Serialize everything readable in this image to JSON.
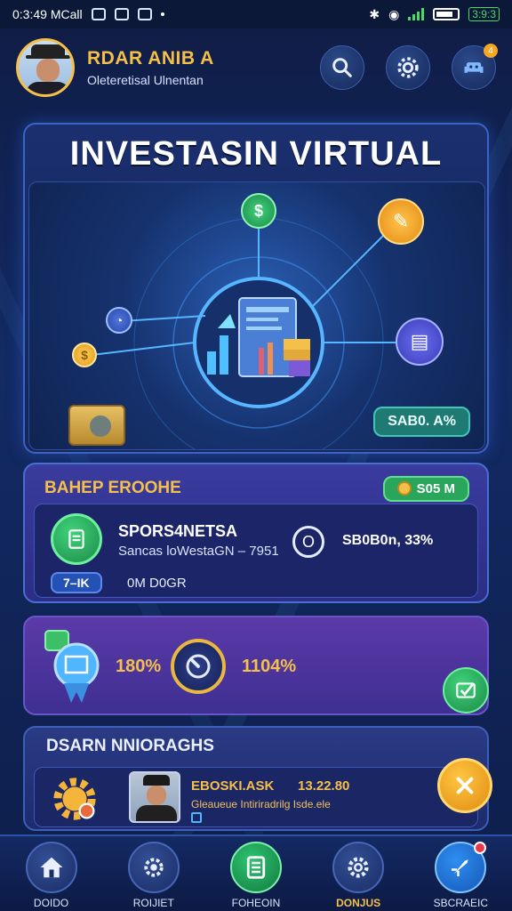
{
  "status_bar": {
    "time_carrier": "0:3:49 MCall",
    "battery_text": "3:9:3"
  },
  "header": {
    "user_name": "RDAR ANIB A",
    "user_subtitle": "Oleteretisal Ulnentan"
  },
  "hero": {
    "title": "INVESTASIN VIRTUAL",
    "badge": "SAB0. A%"
  },
  "balance_card": {
    "title": "BAHEP EROOHE",
    "pill": "S05 M",
    "fund_name": "SPORS4NETSA",
    "fund_desc": "Sancas loWestaGN – 7951",
    "ring_label": "O",
    "fund_value": "SB0B0n, 33%",
    "tag": "7–IK",
    "tag_text": "0M D0GR"
  },
  "stats_card": {
    "stat_one": "180%",
    "stat_two": "1104%"
  },
  "news_card": {
    "title": "DSARN NNIORAGHS",
    "item_title": "EBOSKI.ASK",
    "item_number": "13.22.80",
    "item_subtitle": "Gleaueue Intiriradrilg Isde.ele"
  },
  "bottom_nav": [
    {
      "label": "DOIDO",
      "icon": "home-icon"
    },
    {
      "label": "ROIJIET",
      "icon": "gear-search-icon"
    },
    {
      "label": "FOHEOIN",
      "icon": "list-icon"
    },
    {
      "label": "DONJUS",
      "icon": "gear-icon"
    },
    {
      "label": "SBCRAEIC",
      "icon": "rocket-icon"
    }
  ],
  "colors": {
    "accent_gold": "#f5c04a",
    "accent_green": "#2aa65c",
    "panel_blue": "#1b2e6e",
    "panel_purple": "#3a3b9e"
  }
}
